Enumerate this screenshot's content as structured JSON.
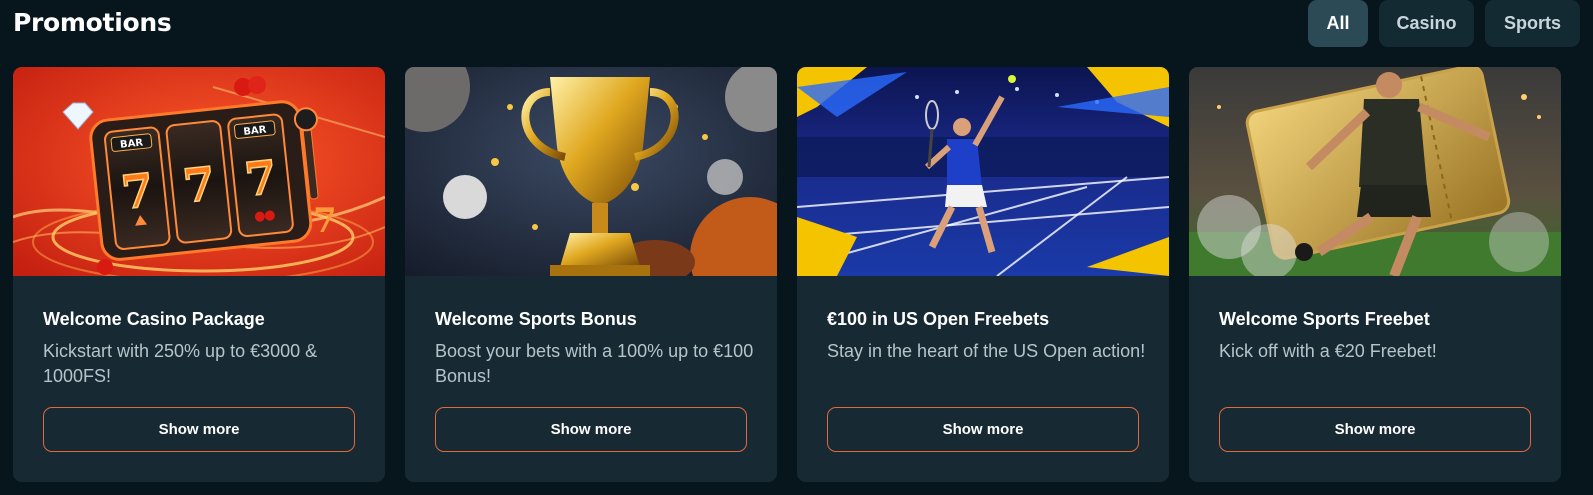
{
  "header": {
    "title": "Promotions"
  },
  "filters": [
    {
      "label": "All",
      "active": true
    },
    {
      "label": "Casino",
      "active": false
    },
    {
      "label": "Sports",
      "active": false
    }
  ],
  "cards": [
    {
      "image": "slot-machine-777-image",
      "title": "Welcome Casino Package",
      "description": "Kickstart with 250% up to €3000 & 1000FS!",
      "button": "Show more",
      "image_text": [
        "BAR",
        "BAR",
        "7",
        "7",
        "7",
        "7"
      ]
    },
    {
      "image": "gold-trophy-image",
      "title": "Welcome Sports Bonus",
      "description": "Boost your bets with a 100% up to €100 Bonus!",
      "button": "Show more"
    },
    {
      "image": "tennis-player-image",
      "title": "€100 in US Open Freebets",
      "description": "Stay in the heart of the US Open action!",
      "button": "Show more"
    },
    {
      "image": "football-player-ticket-image",
      "title": "Welcome Sports Freebet",
      "description": "Kick off with a €20 Freebet!",
      "button": "Show more"
    }
  ],
  "colors": {
    "background": "#07161c",
    "card": "#172a33",
    "accent_border": "#e1683a",
    "filter_active": "#2c4a55",
    "filter_inactive": "#132a33"
  }
}
